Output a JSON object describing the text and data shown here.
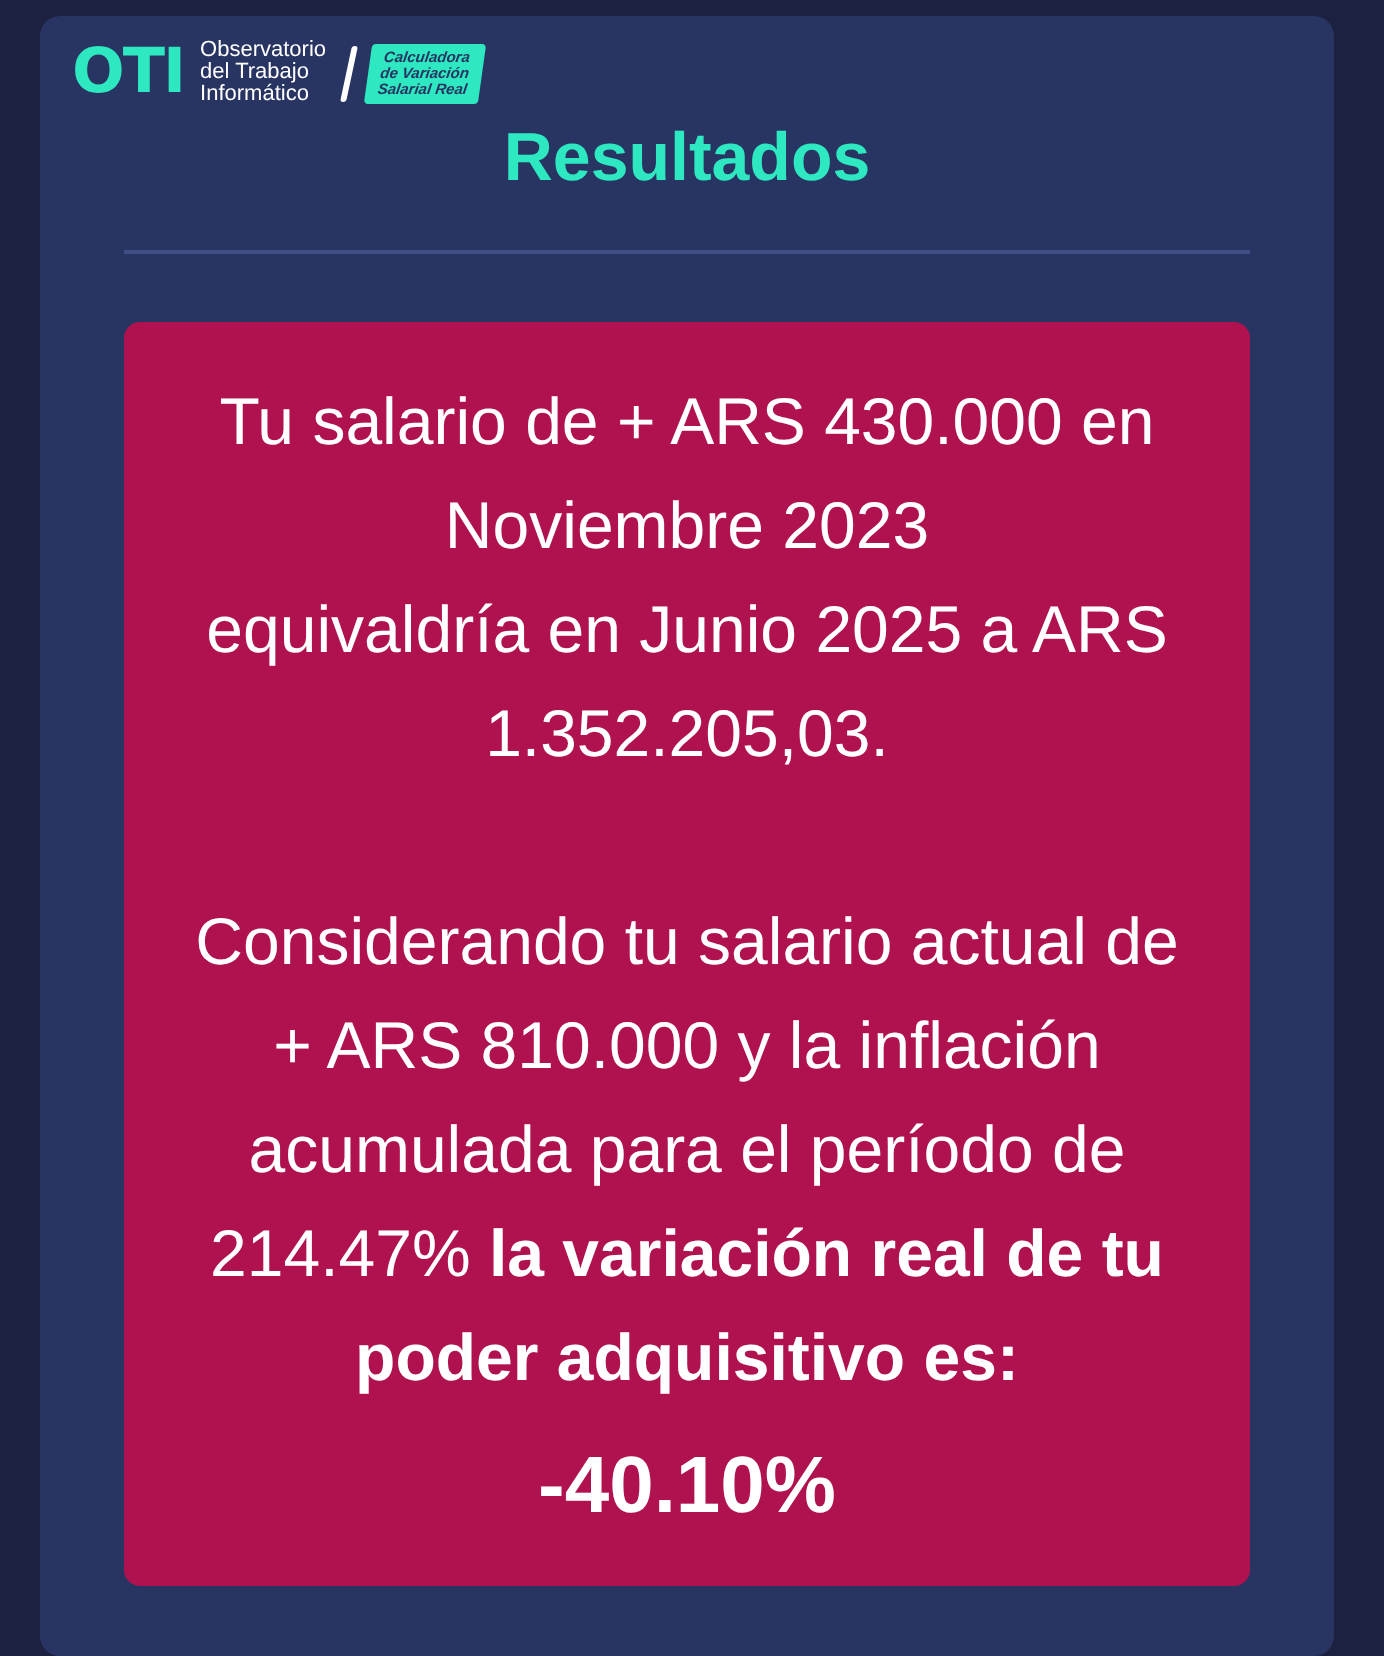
{
  "header": {
    "logo_mark": "OTI",
    "organization_lines": [
      "Observatorio",
      "del Trabajo",
      "Informático"
    ],
    "badge_lines": [
      "Calculadora",
      "de Variación",
      "Salarial Real"
    ]
  },
  "title": "Resultados",
  "result": {
    "summary": "Tu salario de + ARS 430.000 en Noviembre 2023\nequivaldría en Junio 2025 a ARS 1.352.205,03.",
    "detail": "Considerando tu salario actual de + ARS 810.000 y la inflación acumulada para el período de 214.47% **la variación real de tu poder adquisitivo es:**",
    "variation": "-40.10%"
  }
}
